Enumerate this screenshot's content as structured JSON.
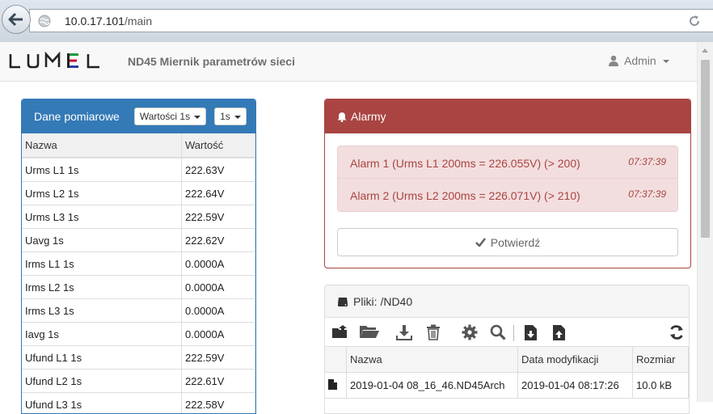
{
  "browser": {
    "url_host": "10.0.17.101",
    "url_path": "/main"
  },
  "navbar": {
    "logo_text": "LUMEL",
    "app_title": "ND45 Miernik parametrów sieci",
    "user_name": "Admin"
  },
  "measurements": {
    "title": "Dane pomiarowe",
    "select_values": "Wartości 1s",
    "select_interval": "1s",
    "columns": [
      "Nazwa",
      "Wartość"
    ],
    "rows": [
      [
        "Urms L1 1s",
        "222.63V"
      ],
      [
        "Urms L2 1s",
        "222.64V"
      ],
      [
        "Urms L3 1s",
        "222.59V"
      ],
      [
        "Uavg 1s",
        "222.62V"
      ],
      [
        "Irms L1 1s",
        "0.0000A"
      ],
      [
        "Irms L2 1s",
        "0.0000A"
      ],
      [
        "Irms L3 1s",
        "0.0000A"
      ],
      [
        "Iavg 1s",
        "0.0000A"
      ],
      [
        "Ufund L1 1s",
        "222.59V"
      ],
      [
        "Ufund L2 1s",
        "222.61V"
      ],
      [
        "Ufund L3 1s",
        "222.58V"
      ]
    ]
  },
  "alarms": {
    "title": "Alarmy",
    "items": [
      {
        "message": "Alarm 1 (Urms L1 200ms = 226.055V) (> 200)",
        "time": "07:37:39"
      },
      {
        "message": "Alarm 2 (Urms L2 200ms = 226.071V) (> 210)",
        "time": "07:37:39"
      }
    ],
    "confirm_label": "Potwierdź"
  },
  "files": {
    "title": "Pliki: /ND40",
    "columns": [
      "Nazwa",
      "Data modyfikacji",
      "Rozmiar"
    ],
    "rows": [
      [
        "2019-01-04 08_16_46.ND45Arch",
        "2019-01-04 08:17:26",
        "10.0 kB"
      ]
    ],
    "toolbar_icons": [
      "folder-up-icon",
      "folder-open-icon",
      "download-icon",
      "trash-icon",
      "gear-icon",
      "search-icon",
      "file-download-icon",
      "file-upload-icon",
      "refresh-icon"
    ]
  },
  "colors": {
    "primary": "#337ab7",
    "danger": "#a94442",
    "danger_bg": "#f2dede"
  }
}
